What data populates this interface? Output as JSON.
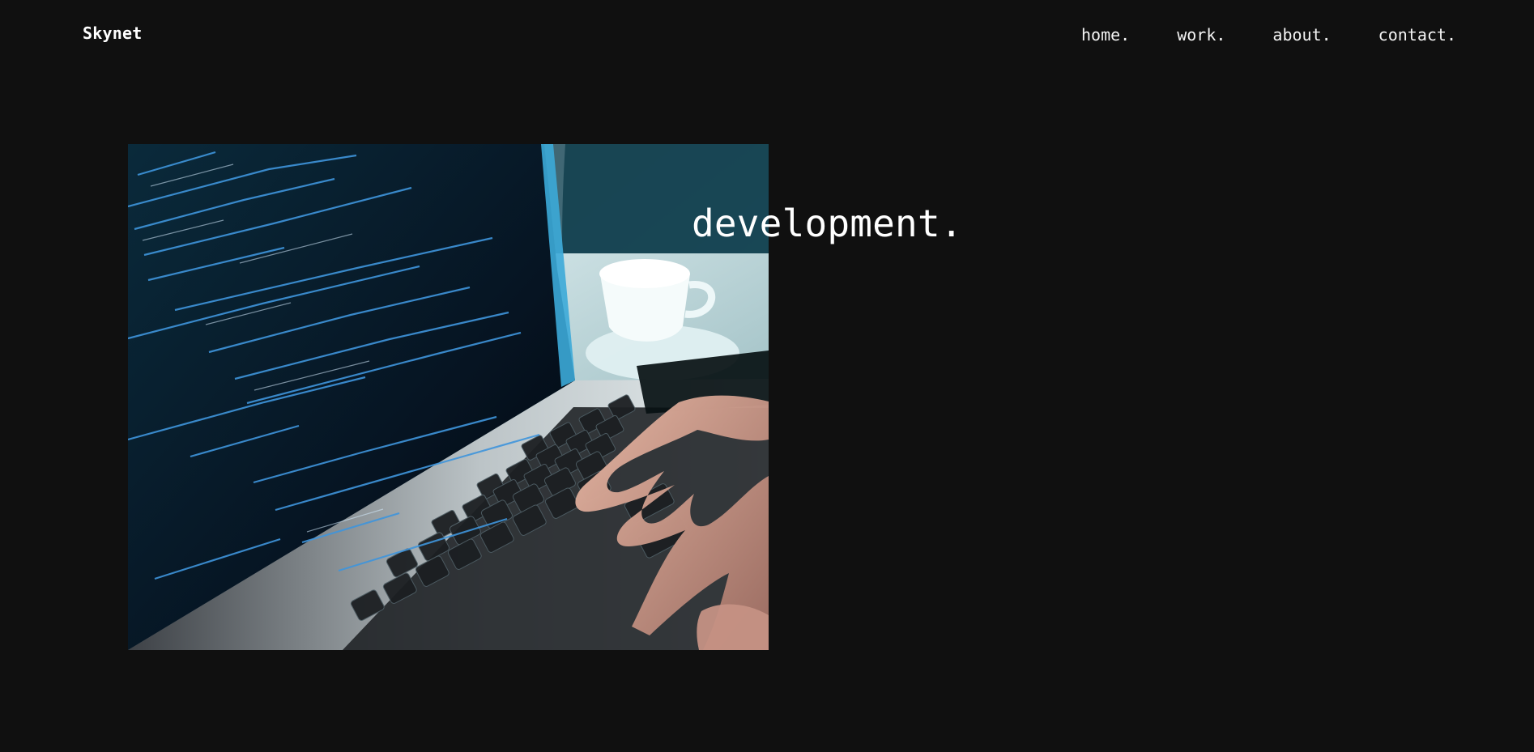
{
  "brand": {
    "name": "Skynet"
  },
  "nav": {
    "items": [
      {
        "label": "home."
      },
      {
        "label": "work."
      },
      {
        "label": "about."
      },
      {
        "label": "contact."
      }
    ]
  },
  "hero": {
    "title": "development.",
    "image": {
      "subject": "laptop-with-code-photo"
    }
  },
  "colors": {
    "background": "#101010",
    "text": "#ffffff",
    "screen_blue": "#1e5a7c",
    "code_blue": "#7fb8ff"
  }
}
